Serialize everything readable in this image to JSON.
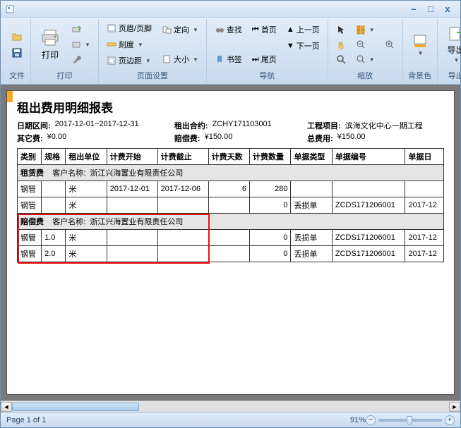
{
  "window": {
    "minimize": "–",
    "maximize": "□",
    "close": "x"
  },
  "ribbon": {
    "file": {
      "label": "文件"
    },
    "print": {
      "label": "打印",
      "print_btn": "打印"
    },
    "page_setup": {
      "label": "页面设置",
      "header_footer": "页眉/页脚",
      "scale": "刻度",
      "margins": "页边距",
      "orientation": "定向",
      "size": "大小"
    },
    "nav": {
      "label": "导航",
      "find": "查找",
      "bookmarks": "书签",
      "first": "首页",
      "prev": "上一页",
      "next": "下一页",
      "last": "尾页"
    },
    "zoom": {
      "label": "缩放"
    },
    "bg": {
      "label": "背景色"
    },
    "export": {
      "label": "导出",
      "export_btn": "导出"
    }
  },
  "report": {
    "title": "租出费用明细报表",
    "meta": {
      "date_range_lbl": "日期区间:",
      "date_range_val": "2017-12-01~2017-12-31",
      "contract_lbl": "租出合约:",
      "contract_val": "ZCHY171103001",
      "project_lbl": "工程项目:",
      "project_val": "滨海文化中心一期工程",
      "other_fee_lbl": "其它费:",
      "other_fee_val": "¥0.00",
      "comp_fee_lbl": "赔偿费:",
      "comp_fee_val": "¥150.00",
      "total_fee_lbl": "总费用:",
      "total_fee_val": "¥150.00"
    },
    "columns": [
      "类别",
      "规格",
      "租出单位",
      "计费开始",
      "计费截止",
      "计费天数",
      "计费数量",
      "单据类型",
      "单据编号",
      "单据日"
    ],
    "sections": [
      {
        "group": "租赁费",
        "cust_lbl": "客户名称:",
        "cust_val": "浙江兴海置业有限责任公司",
        "rows": [
          {
            "c0": "钢管",
            "c1": "",
            "c2": "米",
            "c3": "2017-12-01",
            "c4": "2017-12-06",
            "c5": "6",
            "c6": "280",
            "c7": "",
            "c8": "",
            "c9": ""
          },
          {
            "c0": "钢管",
            "c1": "",
            "c2": "米",
            "c3": "",
            "c4": "",
            "c5": "",
            "c6": "0",
            "c7": "丢损单",
            "c8": "ZCDS171206001",
            "c9": "2017-12"
          }
        ]
      },
      {
        "group": "赔偿费",
        "cust_lbl": "客户名称:",
        "cust_val": "浙江兴海置业有限责任公司",
        "rows": [
          {
            "c0": "钢管",
            "c1": "1.0",
            "c2": "米",
            "c3": "",
            "c4": "",
            "c5": "",
            "c6": "0",
            "c7": "丢损单",
            "c8": "ZCDS171206001",
            "c9": "2017-12"
          },
          {
            "c0": "钢管",
            "c1": "2.0",
            "c2": "米",
            "c3": "",
            "c4": "",
            "c5": "",
            "c6": "0",
            "c7": "丢损单",
            "c8": "ZCDS171206001",
            "c9": "2017-12"
          }
        ]
      }
    ]
  },
  "status": {
    "page": "Page 1 of 1",
    "zoom": "91%"
  }
}
